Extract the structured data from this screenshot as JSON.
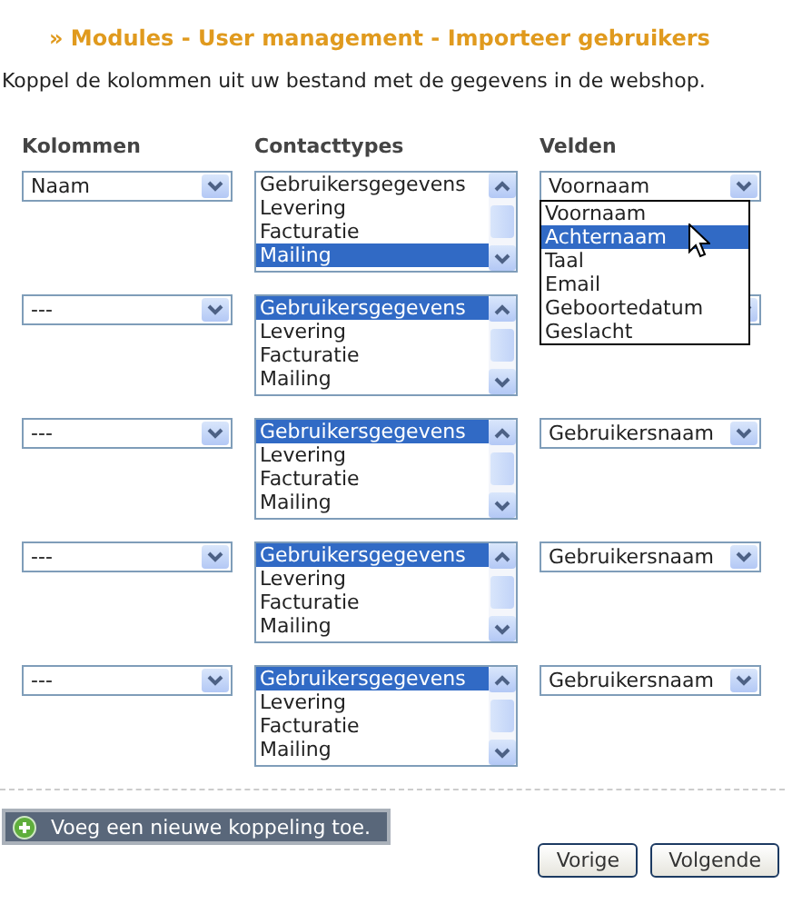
{
  "title": "» Modules - User management - Importeer gebruikers",
  "intro": "Koppel de kolommen uit uw bestand met de gegevens in de webshop.",
  "columns": [
    "Kolommen",
    "Contacttypes",
    "Velden"
  ],
  "rows": [
    {
      "kolom": "Naam",
      "contacttypes": [
        {
          "label": "Gebruikersgegevens",
          "selected": false
        },
        {
          "label": "Levering",
          "selected": false
        },
        {
          "label": "Facturatie",
          "selected": false
        },
        {
          "label": "Mailing",
          "selected": true
        }
      ],
      "veld": "Voornaam",
      "dropdown": {
        "options": [
          {
            "label": "Voornaam",
            "selected": false
          },
          {
            "label": "Achternaam",
            "selected": true
          },
          {
            "label": "Taal",
            "selected": false
          },
          {
            "label": "Email",
            "selected": false
          },
          {
            "label": "Geboortedatum",
            "selected": false
          },
          {
            "label": "Geslacht",
            "selected": false
          }
        ]
      }
    },
    {
      "kolom": "---",
      "contacttypes": [
        {
          "label": "Gebruikersgegevens",
          "selected": true
        },
        {
          "label": "Levering",
          "selected": false
        },
        {
          "label": "Facturatie",
          "selected": false
        },
        {
          "label": "Mailing",
          "selected": false
        }
      ]
    },
    {
      "kolom": "---",
      "contacttypes": [
        {
          "label": "Gebruikersgegevens",
          "selected": true
        },
        {
          "label": "Levering",
          "selected": false
        },
        {
          "label": "Facturatie",
          "selected": false
        },
        {
          "label": "Mailing",
          "selected": false
        }
      ],
      "veld": "Gebruikersnaam"
    },
    {
      "kolom": "---",
      "contacttypes": [
        {
          "label": "Gebruikersgegevens",
          "selected": true
        },
        {
          "label": "Levering",
          "selected": false
        },
        {
          "label": "Facturatie",
          "selected": false
        },
        {
          "label": "Mailing",
          "selected": false
        }
      ],
      "veld": "Gebruikersnaam"
    },
    {
      "kolom": "---",
      "contacttypes": [
        {
          "label": "Gebruikersgegevens",
          "selected": true
        },
        {
          "label": "Levering",
          "selected": false
        },
        {
          "label": "Facturatie",
          "selected": false
        },
        {
          "label": "Mailing",
          "selected": false
        }
      ],
      "veld": "Gebruikersnaam"
    }
  ],
  "add_button": "Voeg een nieuwe koppeling toe.",
  "buttons": [
    "Vorige",
    "Volgende"
  ]
}
